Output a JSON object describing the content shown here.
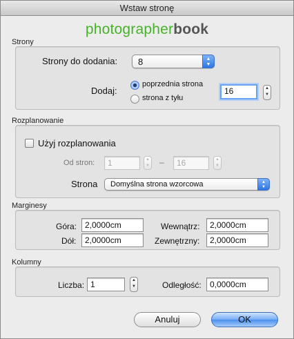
{
  "window": {
    "title": "Wstaw stronę"
  },
  "logo": {
    "part1": "photographer",
    "part2": "book"
  },
  "strony": {
    "section_label": "Strony",
    "pages_to_add_label": "Strony do dodania:",
    "pages_to_add_value": "8",
    "add_label": "Dodaj:",
    "option_previous": "poprzednia strona",
    "option_after": "strona z tyłu",
    "selected_option": "poprzednia strona",
    "page_number": "16"
  },
  "rozplanowanie": {
    "section_label": "Rozplanowanie",
    "use_layout_label": "Użyj rozplanowania",
    "use_layout_checked": false,
    "from_pages_label": "Od stron:",
    "from_value": "1",
    "dash": "–",
    "to_value": "16",
    "page_label": "Strona",
    "page_value": "Domyślna strona wzorcowa"
  },
  "marginesy": {
    "section_label": "Marginesy",
    "top_label": "Góra:",
    "top_value": "2,0000cm",
    "bottom_label": "Dół:",
    "bottom_value": "2,0000cm",
    "inside_label": "Wewnątrz:",
    "inside_value": "2,0000cm",
    "outside_label": "Zewnętrzny:",
    "outside_value": "2,0000cm"
  },
  "kolumny": {
    "section_label": "Kolumny",
    "count_label": "Liczba:",
    "count_value": "1",
    "gap_label": "Odległość:",
    "gap_value": "0,0000cm"
  },
  "buttons": {
    "cancel": "Anuluj",
    "ok": "OK"
  },
  "colors": {
    "logo_green": "#46b327",
    "logo_gray": "#555555",
    "accent_blue": "#4a90ee"
  }
}
